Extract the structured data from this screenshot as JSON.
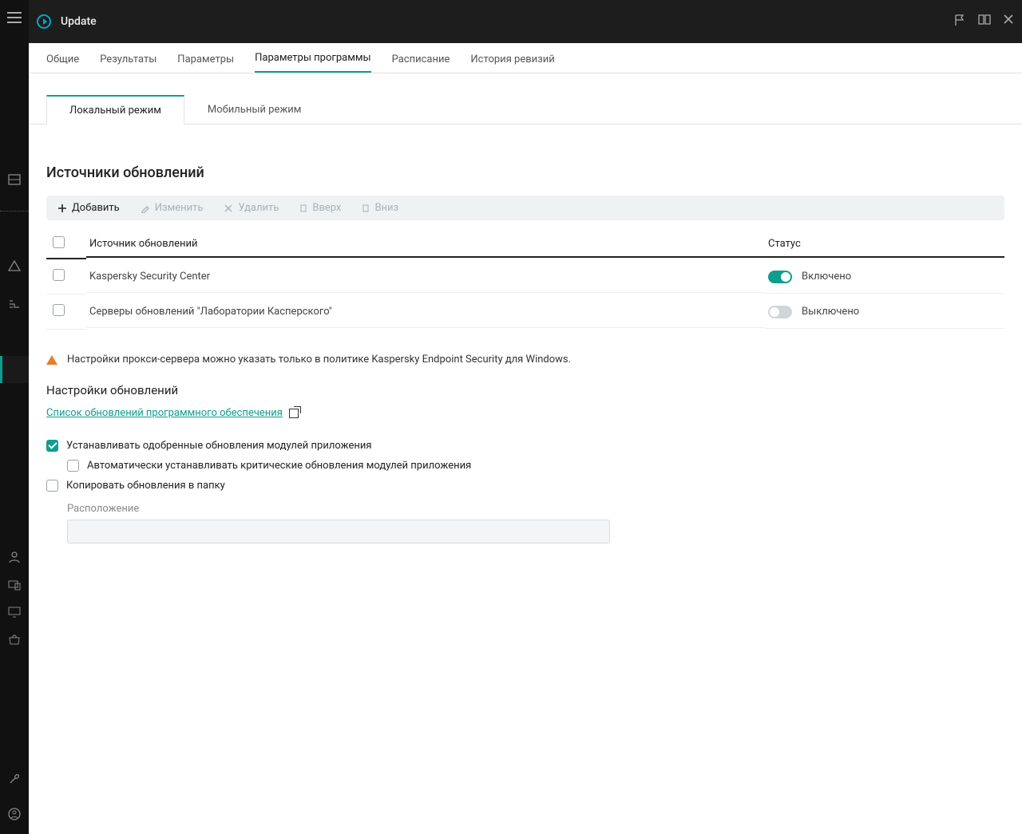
{
  "header": {
    "title": "Update"
  },
  "tabs": [
    {
      "label": "Общие"
    },
    {
      "label": "Результаты"
    },
    {
      "label": "Параметры"
    },
    {
      "label": "Параметры программы",
      "active": true
    },
    {
      "label": "Расписание"
    },
    {
      "label": "История ревизий"
    }
  ],
  "subtabs": [
    {
      "label": "Локальный режим",
      "active": true
    },
    {
      "label": "Мобильный режим"
    }
  ],
  "section": {
    "sources_title": "Источники обновлений"
  },
  "toolbar": {
    "add": "Добавить",
    "edit": "Изменить",
    "delete": "Удалить",
    "up": "Вверх",
    "down": "Вниз"
  },
  "table": {
    "col_source": "Источник обновлений",
    "col_status": "Статус",
    "rows": [
      {
        "source": "Kaspersky Security Center",
        "status_label": "Включено",
        "enabled": true
      },
      {
        "source": "Серверы обновлений \"Лаборатории Касперского\"",
        "status_label": "Выключено",
        "enabled": false
      }
    ]
  },
  "note": {
    "text": "Настройки прокси-сервера можно указать только в политике Kaspersky Endpoint Security для Windows."
  },
  "updates": {
    "settings_title": "Настройки обновлений",
    "link": "Список обновлений программного обеспечения",
    "approved_label": "Устанавливать одобренные обновления модулей приложения",
    "approved_checked": true,
    "auto_critical_label": "Автоматически устанавливать критические обновления модулей приложения",
    "auto_critical_checked": false,
    "copy_label": "Копировать обновления в папку",
    "copy_checked": false,
    "location_label": "Расположение",
    "location_value": ""
  }
}
